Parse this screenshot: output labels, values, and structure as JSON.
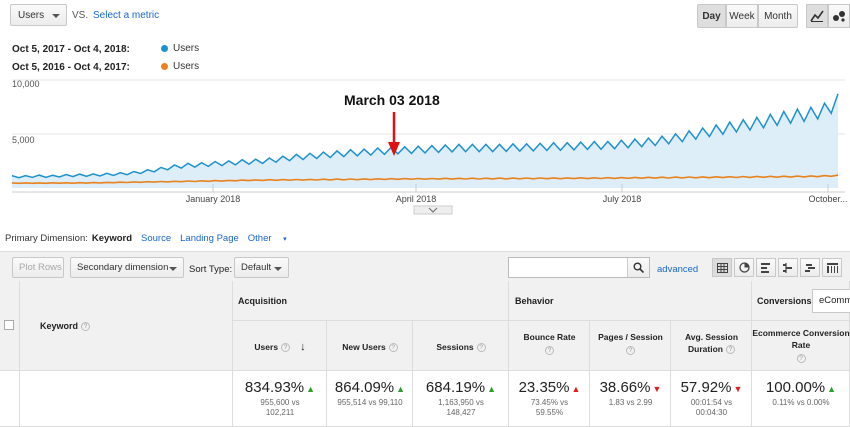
{
  "controls": {
    "metric_select": "Users",
    "vs_label": "VS.",
    "select_metric": "Select a metric",
    "day": "Day",
    "week": "Week",
    "month": "Month"
  },
  "legend": {
    "ranges": [
      {
        "label": "Oct 5, 2017 - Oct 4, 2018:",
        "series": "Users",
        "color": "#1f91cc"
      },
      {
        "label": "Oct 5, 2016 - Oct 4, 2017:",
        "series": "Users",
        "color": "#e8821d"
      }
    ]
  },
  "chart": {
    "annotation": "March 03 2018",
    "y_ticks": [
      "10,000",
      "5,000"
    ],
    "x_ticks": [
      "January 2018",
      "April 2018",
      "July 2018",
      "October..."
    ]
  },
  "chart_data": {
    "type": "line",
    "ylim": [
      0,
      10000
    ],
    "x_ticks": [
      "January 2018",
      "April 2018",
      "July 2018",
      "October..."
    ],
    "series": [
      {
        "name": "Users",
        "range": "Oct 5, 2017 - Oct 4, 2018",
        "color": "#1f91cc",
        "weekly_trend": [
          1050,
          1050,
          1100,
          1080,
          1150,
          1180,
          1200,
          1250,
          1300,
          1400,
          1550,
          1750,
          1950,
          2100,
          2150,
          2250,
          2300,
          2400,
          2450,
          2550,
          2700,
          2850,
          2950,
          3050,
          3150,
          3250,
          3300,
          3400,
          3450,
          3500,
          3550,
          3600,
          3650,
          3700,
          3700,
          3700,
          3700,
          3750,
          3750,
          3800,
          3850,
          3850,
          3900,
          3950,
          3950,
          4050,
          4150,
          4250,
          4400,
          4600,
          4850,
          5100,
          5350,
          5600,
          5800,
          6000,
          6250,
          6500,
          6700,
          6850,
          7200,
          8000
        ]
      },
      {
        "name": "Users",
        "range": "Oct 5, 2016 - Oct 4, 2017",
        "color": "#e8821d",
        "weekly_trend": [
          450,
          450,
          450,
          460,
          460,
          470,
          480,
          500,
          520,
          540,
          560,
          580,
          600,
          620,
          640,
          660,
          680,
          700,
          720,
          740,
          750,
          760,
          770,
          780,
          790,
          800,
          810,
          820,
          830,
          840,
          850,
          850,
          860,
          860,
          870,
          870,
          880,
          880,
          890,
          890,
          900,
          900,
          910,
          910,
          920,
          930,
          940,
          950,
          960,
          970,
          980,
          990,
          1000,
          1010,
          1020,
          1030,
          1040,
          1050,
          1060,
          1080,
          1100,
          1150
        ]
      }
    ]
  },
  "primary_dimension": {
    "label": "Primary Dimension:",
    "active": "Keyword",
    "options": [
      "Source",
      "Landing Page",
      "Other"
    ]
  },
  "toolbar": {
    "plot_rows": "Plot Rows",
    "secondary_dimension": "Secondary dimension",
    "sort_type_label": "Sort Type:",
    "sort_type_value": "Default",
    "advanced": "advanced"
  },
  "table": {
    "keyword_header": "Keyword",
    "groups": {
      "acquisition": "Acquisition",
      "behavior": "Behavior",
      "conversions": "Conversions",
      "conversions_select": "eComm"
    },
    "columns": [
      {
        "header": "Users",
        "value": "834.93%",
        "trend": "up",
        "sub1": "955,600 vs",
        "sub2": "102,211"
      },
      {
        "header": "New Users",
        "value": "864.09%",
        "trend": "up",
        "sub1": "955,514 vs 99,110",
        "sub2": ""
      },
      {
        "header": "Sessions",
        "value": "684.19%",
        "trend": "up",
        "sub1": "1,163,950 vs",
        "sub2": "148,427"
      },
      {
        "header": "Bounce Rate",
        "value": "23.35%",
        "trend": "down",
        "sub1": "73.45% vs",
        "sub2": "59.55%"
      },
      {
        "header": "Pages / Session",
        "value": "38.66%",
        "trend": "down",
        "sub1": "1.83 vs 2.99",
        "sub2": ""
      },
      {
        "header": "Avg. Session Duration",
        "value": "57.92%",
        "trend": "down",
        "sub1": "00:01:54 vs",
        "sub2": "00:04:30"
      },
      {
        "header": "Ecommerce Conversion Rate",
        "value": "100.00%",
        "trend": "up",
        "sub1": "0.11% vs 0.00%",
        "sub2": ""
      }
    ]
  }
}
